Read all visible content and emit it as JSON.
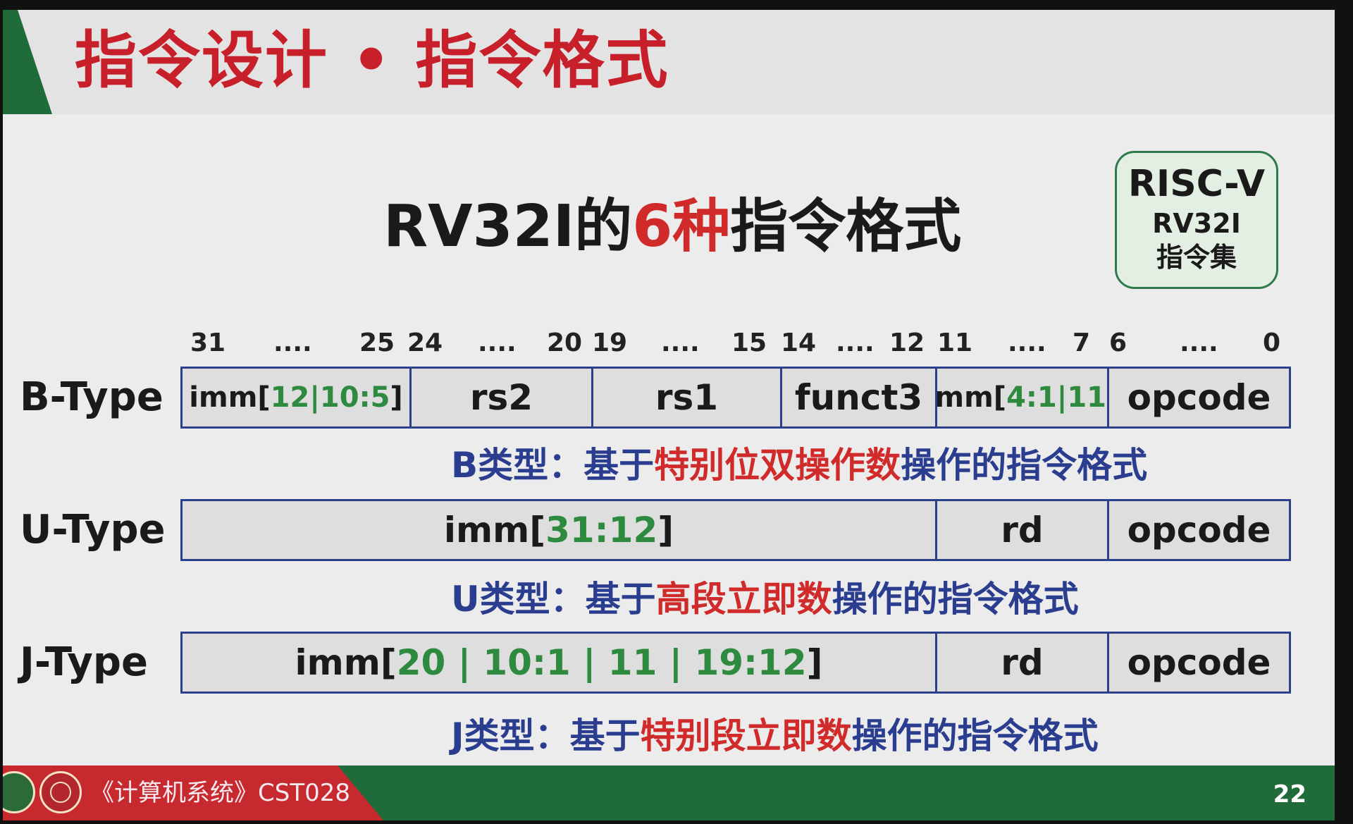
{
  "slide": {
    "title": "指令设计 • 指令格式",
    "heading": {
      "pre": "RV32I的",
      "highlight": "6种",
      "post": "指令格式"
    },
    "badge": {
      "line1": "RISC-V",
      "line2": "RV32I",
      "line3": "指令集"
    }
  },
  "bit_positions": [
    "31",
    "....",
    "25",
    "24",
    "....",
    "20",
    "19",
    "....",
    "15",
    "14",
    "....",
    "12",
    "11",
    "....",
    "7",
    "6",
    "....",
    "0"
  ],
  "formats": {
    "b_type": {
      "label": "B-Type",
      "fields": {
        "f1_pre": "imm[",
        "f1_bits": "12|10:5",
        "f1_post": "]",
        "f2": "rs2",
        "f3": "rs1",
        "f4": "funct3",
        "f5_pre": "imm[",
        "f5_bits": "4:1|11",
        "f5_post": "]",
        "f6": "opcode"
      },
      "desc": {
        "pre": "B类型：基于",
        "highlight": "特别位双操作数",
        "post": "操作的指令格式"
      }
    },
    "u_type": {
      "label": "U-Type",
      "fields": {
        "f1_pre": "imm[",
        "f1_bits": "31:12",
        "f1_post": "]",
        "f2": "rd",
        "f3": "opcode"
      },
      "desc": {
        "pre": "U类型：基于",
        "highlight": "高段立即数",
        "post": "操作的指令格式"
      }
    },
    "j_type": {
      "label": "J-Type",
      "fields": {
        "f1_pre": "imm[",
        "f1_bits": "20 | 10:1 | 11 | 19:12",
        "f1_post": "]",
        "f2": "rd",
        "f3": "opcode"
      },
      "desc": {
        "pre": "J类型：基于",
        "highlight": "特别段立即数",
        "post": "操作的指令格式"
      }
    }
  },
  "footer": {
    "course": "《计算机系统》CST028",
    "page": "22"
  },
  "colors": {
    "title_red": "#c8202a",
    "accent_green": "#1f6b3a",
    "field_border": "#2c3f8a",
    "bits_green": "#2e8a3e",
    "desc_blue": "#2a3d8f"
  }
}
